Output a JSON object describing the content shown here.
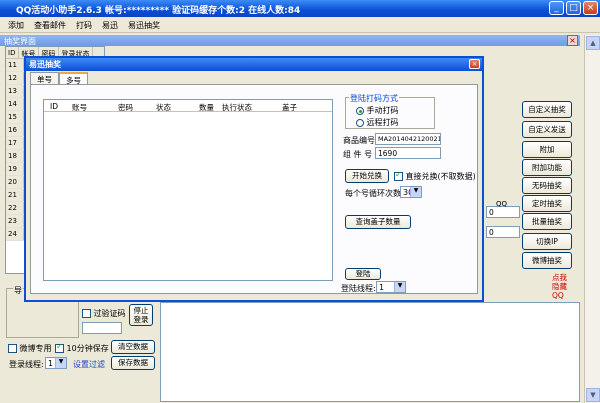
{
  "window": {
    "title": "QQ活动小助手2.6.3    帐号:*********   验证码缓存个数:2      在线人数:84",
    "minimize": "_",
    "maximize": "□",
    "close": "×"
  },
  "menu": [
    "添加",
    "查看邮件",
    "打码",
    "易迅",
    "易迅抽奖"
  ],
  "subwindow": {
    "title": "抽奖界面",
    "close": "×"
  },
  "bg_table": {
    "headers": [
      "ID",
      "帐号",
      "密码",
      "登录状态"
    ],
    "rows": [
      "11",
      "12",
      "13",
      "14",
      "15",
      "16",
      "17",
      "18",
      "19",
      "20",
      "21",
      "22",
      "23",
      "24"
    ]
  },
  "right_buttons": [
    "自定义抽奖",
    "自定义发送",
    "附加",
    "附加功能",
    "无码抽奖",
    "定时抽奖",
    "批量抽奖",
    "切换IP",
    "微博抽奖"
  ],
  "side_red_text": "点我隐藏QQ",
  "bg_fields": {
    "field1": "0",
    "field2": "0",
    "qq_label": "QQ"
  },
  "bottom_left": {
    "group_label": "导",
    "skip_captcha": "过验证码",
    "stop_login": "停止登录",
    "weibo_only": "微博专用",
    "save_10min": "10分钟保存",
    "clear_data": "清空数据",
    "login_threads_label": "登录线程:",
    "login_threads_value": "1",
    "set_filter": "设置过滤",
    "save_data": "保存数据"
  },
  "dialog": {
    "title": "易迅抽奖",
    "close": "×",
    "tabs": [
      "单号",
      "多号"
    ],
    "active_tab": 1,
    "grid_headers": [
      "ID",
      "账号",
      "密码",
      "状态",
      "数量",
      "执行状态",
      "盖子"
    ],
    "login_group_title": "登陆打码方式",
    "radio_manual": "手动打码",
    "radio_remote": "远程打码",
    "product_label": "商品编号",
    "product_value": "MA201404212002196",
    "group_label": "组   件   号",
    "group_value": "1690",
    "start_exchange": "开始兑换",
    "direct_exchange": "直接兑换(不取数据)",
    "loop_label": "每个号循环次数:",
    "loop_value": "30",
    "query_caps": "查询盖子数量",
    "login": "登陆",
    "login_threads_label": "登陆线程:",
    "login_threads_value": "1"
  }
}
